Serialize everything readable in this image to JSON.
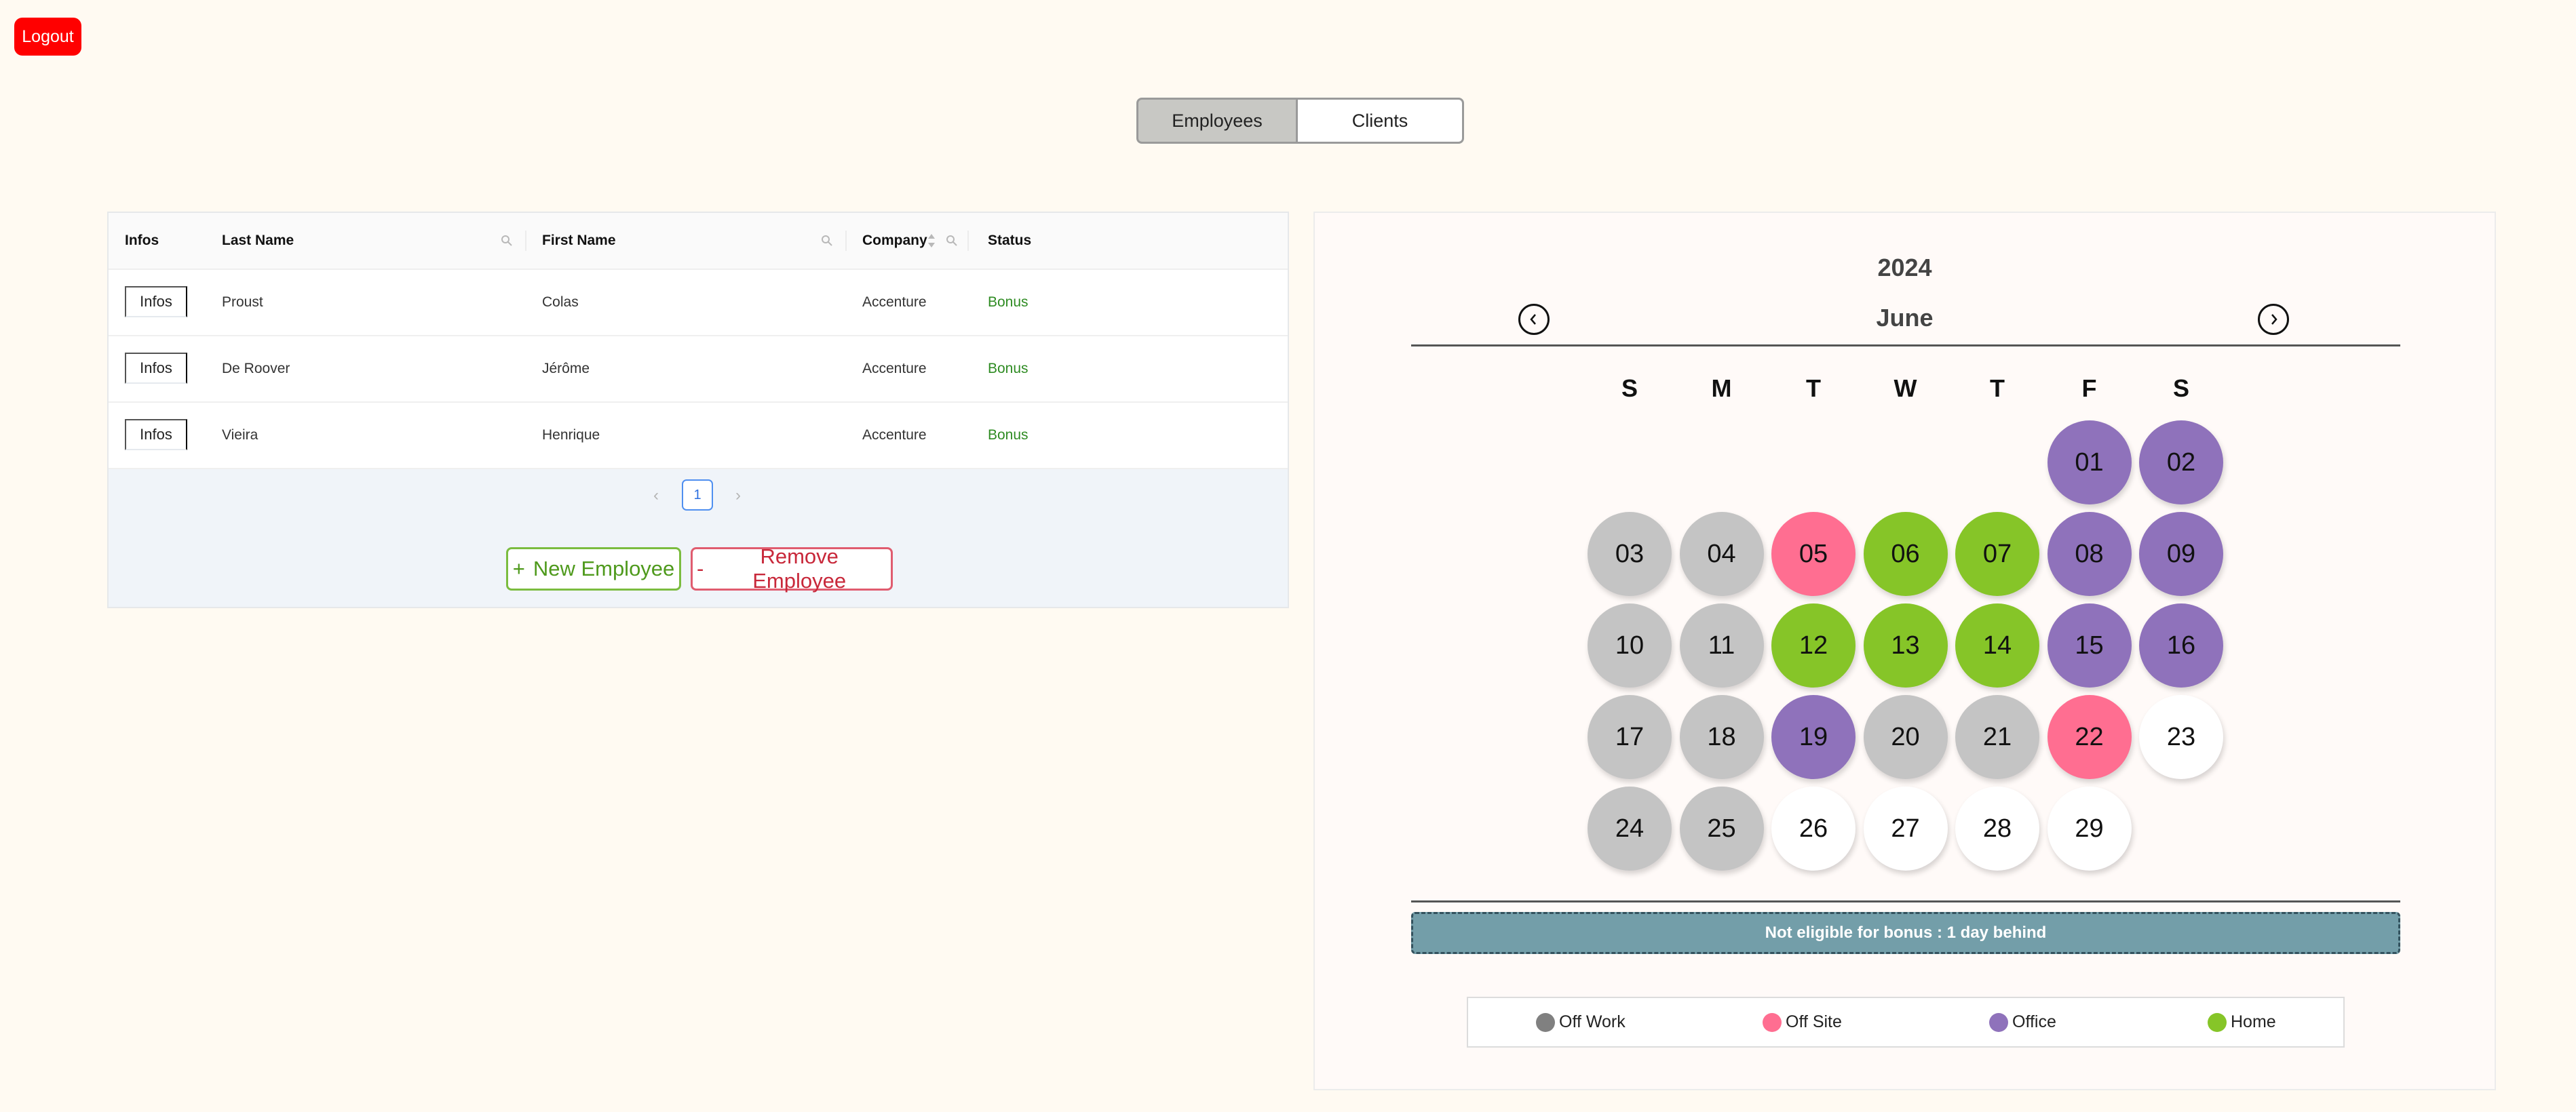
{
  "header": {
    "logout_label": "Logout"
  },
  "tabs": [
    {
      "label": "Employees",
      "active": true
    },
    {
      "label": "Clients",
      "active": false
    }
  ],
  "table": {
    "columns": [
      "Infos",
      "Last Name",
      "First Name",
      "Company",
      "Status"
    ],
    "rows": [
      {
        "infos": "Infos",
        "last_name": "Proust",
        "first_name": "Colas",
        "company": "Accenture",
        "status": "Bonus"
      },
      {
        "infos": "Infos",
        "last_name": "De Roover",
        "first_name": "Jérôme",
        "company": "Accenture",
        "status": "Bonus"
      },
      {
        "infos": "Infos",
        "last_name": "Vieira",
        "first_name": "Henrique",
        "company": "Accenture",
        "status": "Bonus"
      }
    ],
    "pagination": {
      "current_page": "1"
    },
    "new_button": {
      "icon": "+",
      "label": "New Employee"
    },
    "remove_button": {
      "icon": "-",
      "label": "Remove Employee"
    }
  },
  "calendar": {
    "year": "2024",
    "month": "June",
    "weekdays": [
      "S",
      "M",
      "T",
      "W",
      "T",
      "F",
      "S"
    ],
    "first_weekday_index": 5,
    "days": [
      {
        "day": "01",
        "type": "office"
      },
      {
        "day": "02",
        "type": "office"
      },
      {
        "day": "03",
        "type": "off_work"
      },
      {
        "day": "04",
        "type": "off_work"
      },
      {
        "day": "05",
        "type": "off_site"
      },
      {
        "day": "06",
        "type": "home"
      },
      {
        "day": "07",
        "type": "home"
      },
      {
        "day": "08",
        "type": "office"
      },
      {
        "day": "09",
        "type": "office"
      },
      {
        "day": "10",
        "type": "off_work"
      },
      {
        "day": "11",
        "type": "off_work"
      },
      {
        "day": "12",
        "type": "home"
      },
      {
        "day": "13",
        "type": "home"
      },
      {
        "day": "14",
        "type": "home"
      },
      {
        "day": "15",
        "type": "office"
      },
      {
        "day": "16",
        "type": "office"
      },
      {
        "day": "17",
        "type": "off_work"
      },
      {
        "day": "18",
        "type": "off_work"
      },
      {
        "day": "19",
        "type": "office"
      },
      {
        "day": "20",
        "type": "off_work"
      },
      {
        "day": "21",
        "type": "off_work"
      },
      {
        "day": "22",
        "type": "off_site"
      },
      {
        "day": "23",
        "type": "none"
      },
      {
        "day": "24",
        "type": "off_work"
      },
      {
        "day": "25",
        "type": "off_work"
      },
      {
        "day": "26",
        "type": "none"
      },
      {
        "day": "27",
        "type": "none"
      },
      {
        "day": "28",
        "type": "none"
      },
      {
        "day": "29",
        "type": "none"
      }
    ],
    "status_message": "Not eligible for bonus : 1 day behind",
    "legend": [
      {
        "key": "off_work",
        "label": "Off Work"
      },
      {
        "key": "off_site",
        "label": "Off Site"
      },
      {
        "key": "office",
        "label": "Office"
      },
      {
        "key": "home",
        "label": "Home"
      }
    ]
  },
  "colors": {
    "off_work": "#c4c4c4",
    "off_work_legend": "#808080",
    "off_site": "#ff6e91",
    "office": "#8f72bb",
    "home": "#86c528",
    "none": "#ffffff",
    "logout": "#ff0000",
    "bonus_text": "#2e8b22"
  }
}
